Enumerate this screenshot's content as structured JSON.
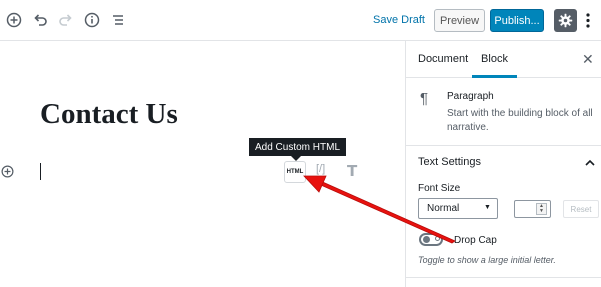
{
  "toolbar": {
    "save_draft": "Save Draft",
    "preview": "Preview",
    "publish": "Publish...",
    "icons": [
      "add-block-icon",
      "undo-icon",
      "redo-icon",
      "info-icon",
      "block-navigation-icon",
      "gear-icon",
      "more-options-icon"
    ]
  },
  "editor": {
    "title": "Contact Us",
    "tooltip": "Add Custom HTML",
    "html_button": "HTML",
    "shortcode_button": "[/]",
    "heading_button": "T"
  },
  "sidebar": {
    "tabs": [
      "Document",
      "Block"
    ],
    "active_tab": "Block",
    "block_name": "Paragraph",
    "block_description": "Start with the building block of all narrative.",
    "panel_title": "Text Settings",
    "font_size_label": "Font Size",
    "font_size_value": "Normal",
    "reset_label": "Reset",
    "drop_cap_label": "Drop Cap",
    "drop_cap_help": "Toggle to show a large initial letter.",
    "drop_cap_enabled": false
  },
  "colors": {
    "accent": "#0085ba",
    "link": "#0073aa",
    "annotation_arrow": "#e8120f",
    "tooltip_bg": "#191e23"
  }
}
